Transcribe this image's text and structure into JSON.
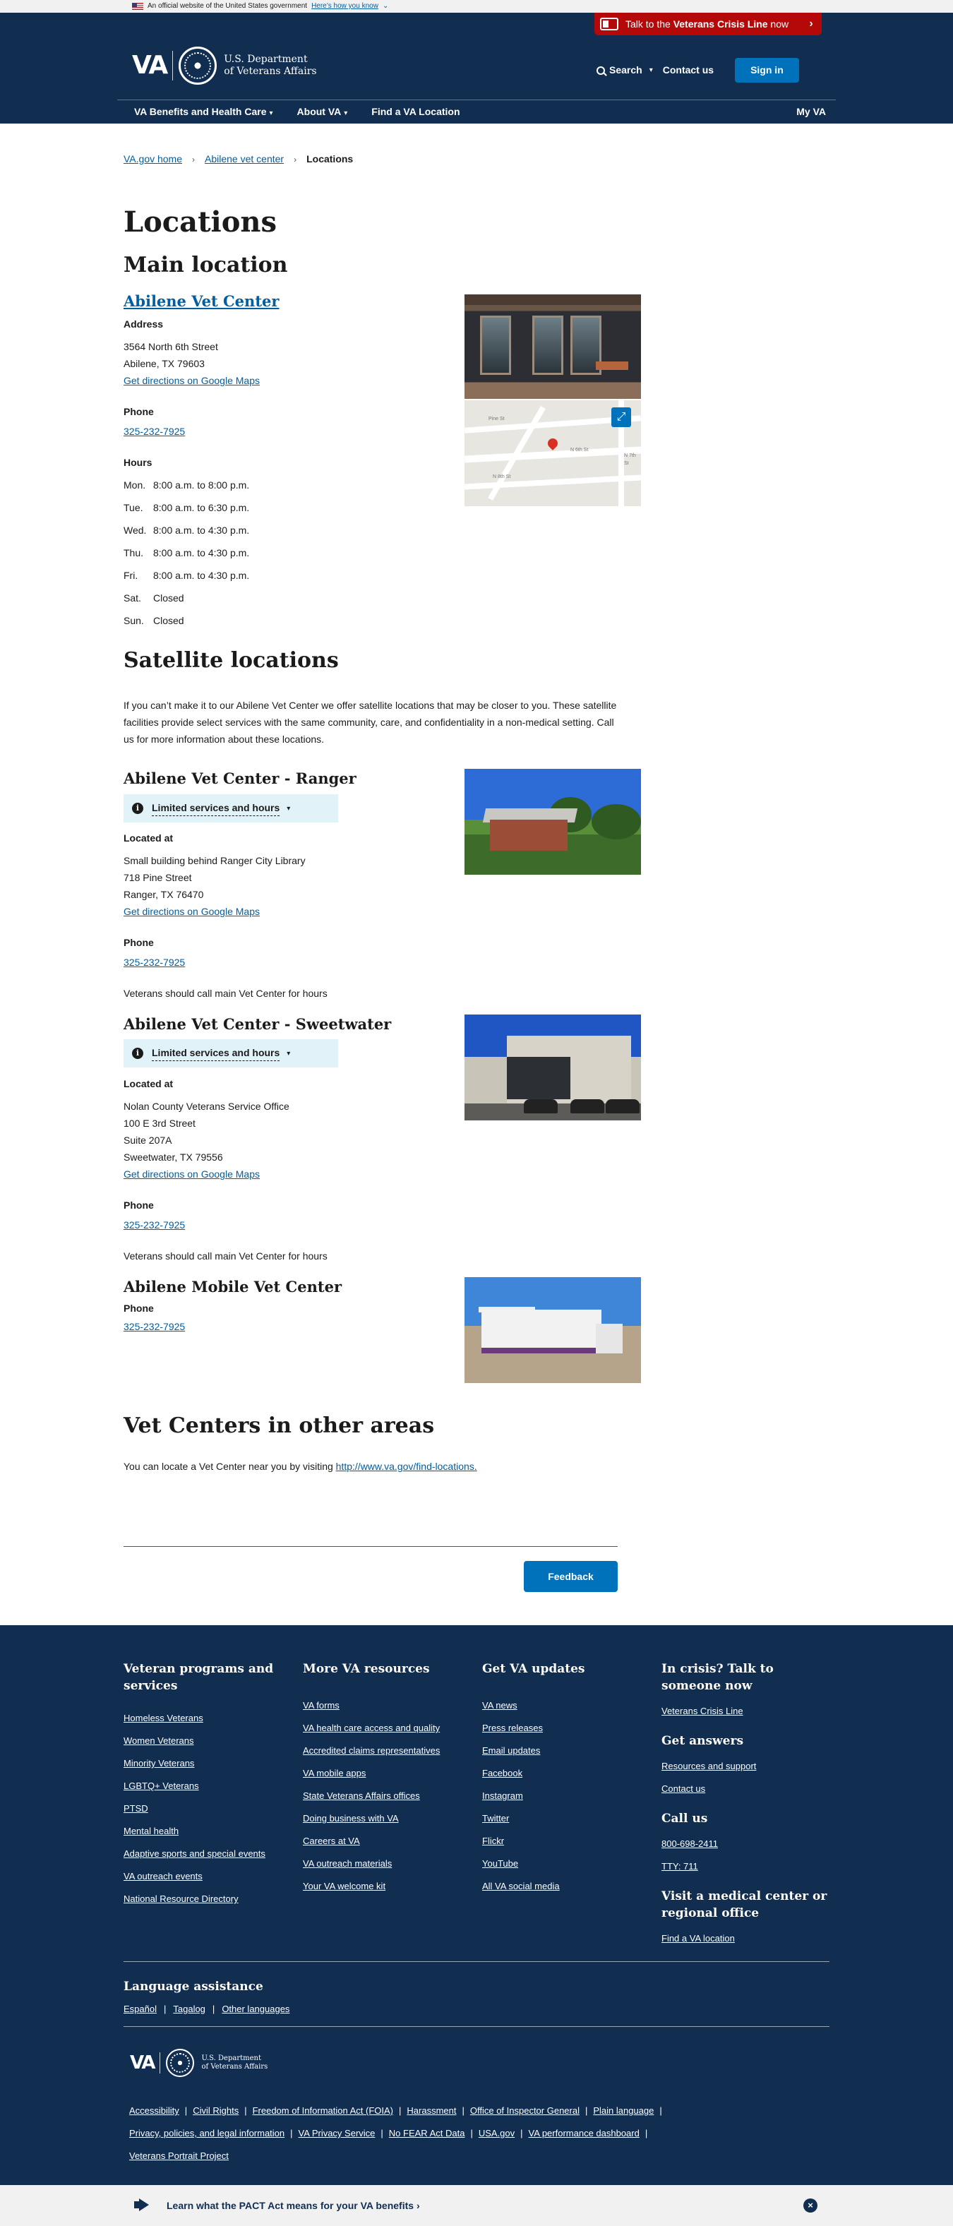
{
  "gov_banner": {
    "text": "An official website of the United States government",
    "link": "Here’s how you know"
  },
  "crisis": {
    "pre": "Talk to the ",
    "bold": "Veterans Crisis Line",
    "post": " now"
  },
  "header": {
    "logo": "VA",
    "dept_line1": "U.S. Department",
    "dept_line2": "of Veterans Affairs",
    "search": "Search",
    "contact": "Contact us",
    "signin": "Sign in"
  },
  "nav": {
    "items": [
      "VA Benefits and Health Care",
      "About VA",
      "Find a VA Location"
    ],
    "myva": "My VA"
  },
  "breadcrumb": [
    "VA.gov home",
    "Abilene vet center",
    "Locations"
  ],
  "page": {
    "title": "Locations",
    "main_heading": "Main location",
    "main": {
      "name": "Abilene Vet Center",
      "address_label": "Address",
      "address_line1": "3564 North 6th Street",
      "address_line2": "Abilene, TX 79603",
      "directions": "Get directions on Google Maps",
      "phone_label": "Phone",
      "phone": "325-232-7925",
      "hours_label": "Hours",
      "hours": [
        {
          "day": "Mon.",
          "time": "8:00 a.m. to 8:00 p.m."
        },
        {
          "day": "Tue.",
          "time": "8:00 a.m. to 6:30 p.m."
        },
        {
          "day": "Wed.",
          "time": "8:00 a.m. to 4:30 p.m."
        },
        {
          "day": "Thu.",
          "time": "8:00 a.m. to 4:30 p.m."
        },
        {
          "day": "Fri.",
          "time": "8:00 a.m. to 4:30 p.m."
        },
        {
          "day": "Sat.",
          "time": "Closed"
        },
        {
          "day": "Sun.",
          "time": "Closed"
        }
      ],
      "map_labels": [
        "Pine St",
        "N 6th St",
        "N 8th St",
        "N 7th St"
      ]
    },
    "satellite_heading": "Satellite locations",
    "satellite_intro": "If you can’t make it to our Abilene Vet Center we offer satellite locations that may be closer to you. These satellite facilities provide select services with the same community, care, and confidentiality in a non-medical setting. Call us for more information about these locations.",
    "ranger": {
      "name": "Abilene Vet Center - Ranger",
      "alert": "Limited services and hours",
      "located_label": "Located at",
      "lines": [
        "Small building behind Ranger City Library",
        "718 Pine Street",
        "Ranger, TX 76470"
      ],
      "directions": "Get directions on Google Maps",
      "phone_label": "Phone",
      "phone": "325-232-7925",
      "note": "Veterans should call main Vet Center for hours"
    },
    "sweetwater": {
      "name": "Abilene Vet Center - Sweetwater",
      "alert": "Limited services and hours",
      "located_label": "Located at",
      "lines": [
        "Nolan County Veterans Service Office",
        "100 E 3rd Street",
        "Suite 207A",
        "Sweetwater, TX 79556"
      ],
      "directions": "Get directions on Google Maps",
      "phone_label": "Phone",
      "phone": "325-232-7925",
      "note": "Veterans should call main Vet Center for hours"
    },
    "mobile": {
      "name": "Abilene Mobile Vet Center",
      "phone_label": "Phone",
      "phone": "325-232-7925"
    },
    "other_heading": "Vet Centers in other areas",
    "other_text": "You can locate a Vet Center near you by visiting ",
    "other_link": "http://www.va.gov/find-locations.",
    "feedback": "Feedback"
  },
  "footer": {
    "col1": {
      "title": "Veteran programs and services",
      "links": [
        "Homeless Veterans",
        "Women Veterans",
        "Minority Veterans",
        "LGBTQ+ Veterans",
        "PTSD",
        "Mental health",
        "Adaptive sports and special events",
        "VA outreach events",
        "National Resource Directory"
      ]
    },
    "col2": {
      "title": "More VA resources",
      "links": [
        "VA forms",
        "VA health care access and quality",
        "Accredited claims representatives",
        "VA mobile apps",
        "State Veterans Affairs offices",
        "Doing business with VA",
        "Careers at VA",
        "VA outreach materials",
        "Your VA welcome kit"
      ]
    },
    "col3": {
      "title": "Get VA updates",
      "links": [
        "VA news",
        "Press releases",
        "Email updates",
        "Facebook",
        "Instagram",
        "Twitter",
        "Flickr",
        "YouTube",
        "All VA social media"
      ]
    },
    "col4": {
      "crisis_title": "In crisis? Talk to someone now",
      "crisis_link": "Veterans Crisis Line",
      "answers_title": "Get answers",
      "answers_links": [
        "Resources and support",
        "Contact us"
      ],
      "call_title": "Call us",
      "call_links": [
        "800-698-2411",
        "TTY: 711"
      ],
      "visit_title": "Visit a medical center or regional office",
      "visit_link": "Find a VA location"
    },
    "language": {
      "title": "Language assistance",
      "links": [
        "Español",
        "Tagalog",
        "Other languages"
      ]
    },
    "bottom_links": [
      "Accessibility",
      "Civil Rights",
      "Freedom of Information Act (FOIA)",
      "Harassment",
      "Office of Inspector General",
      "Plain language",
      "Privacy, policies, and legal information",
      "VA Privacy Service",
      "No FEAR Act Data",
      "USA.gov",
      "VA performance dashboard",
      "Veterans Portrait Project"
    ]
  },
  "pact": {
    "text": "Learn what the PACT Act means for your VA benefits",
    "arrow": "›"
  },
  "colors": {
    "header_bg": "#112e51",
    "link": "#005ea2",
    "crisis": "#b50909",
    "button": "#0071bb",
    "alert_bg": "#e1f3f8"
  }
}
